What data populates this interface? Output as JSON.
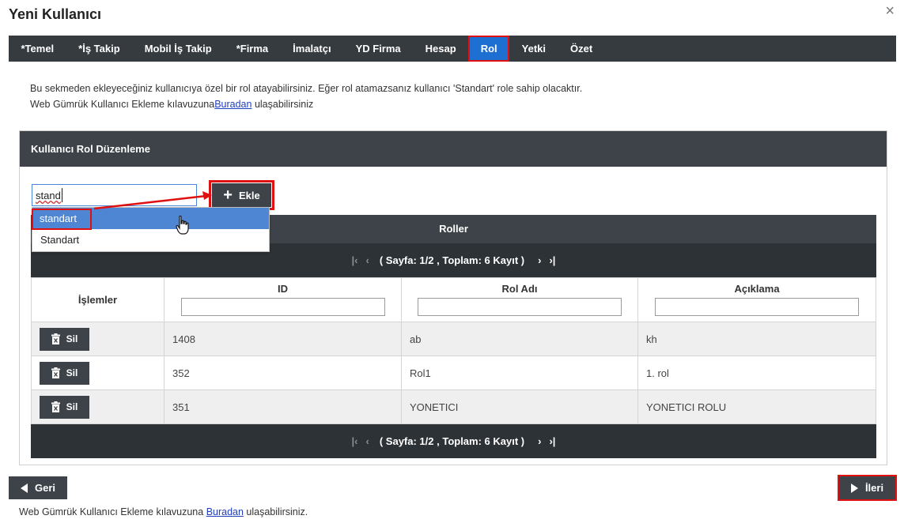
{
  "window": {
    "title": "Yeni Kullanıcı",
    "close_glyph": "×"
  },
  "tabs": [
    {
      "label": "*Temel"
    },
    {
      "label": "*İş Takip"
    },
    {
      "label": "Mobil İş Takip"
    },
    {
      "label": "*Firma"
    },
    {
      "label": "İmalatçı"
    },
    {
      "label": "YD Firma"
    },
    {
      "label": "Hesap"
    },
    {
      "label": "Rol",
      "active": true
    },
    {
      "label": "Yetki"
    },
    {
      "label": "Özet"
    }
  ],
  "info": {
    "line1": "Bu sekmeden ekleyeceğiniz kullanıcıya özel bir rol atayabilirsiniz. Eğer rol atamazsanız kullanıcı 'Standart' role sahip olacaktır.",
    "line2_prefix": "Web Gümrük Kullanıcı Ekleme kılavuzuna",
    "line2_link": "Buradan",
    "line2_suffix": " ulaşabilirsiniz"
  },
  "panel": {
    "title": "Kullanıcı Rol Düzenleme",
    "search_value": "stand",
    "add_button": "Ekle",
    "dropdown": [
      "standart",
      "Standart"
    ]
  },
  "grid": {
    "title": "Roller",
    "pager_text": "( Sayfa: 1/2 , Toplam: 6 Kayıt )",
    "columns": {
      "ops": "İşlemler",
      "id": "ID",
      "name": "Rol Adı",
      "desc": "Açıklama"
    },
    "delete_label": "Sil",
    "rows": [
      {
        "id": "1408",
        "name": "ab",
        "desc": "kh"
      },
      {
        "id": "352",
        "name": "Rol1",
        "desc": "1. rol"
      },
      {
        "id": "351",
        "name": "YONETICI",
        "desc": "YONETICI ROLU"
      }
    ]
  },
  "nav": {
    "back": "Geri",
    "next": "İleri"
  },
  "footer": {
    "prefix": "Web Gümrük Kullanıcı Ekleme kılavuzuna ",
    "link": "Buradan",
    "suffix": " ulaşabilirsiniz."
  },
  "colors": {
    "dark": "#3d4349",
    "active_tab": "#1d6fd1",
    "highlight": "#e01010",
    "selected": "#4f86d4"
  }
}
